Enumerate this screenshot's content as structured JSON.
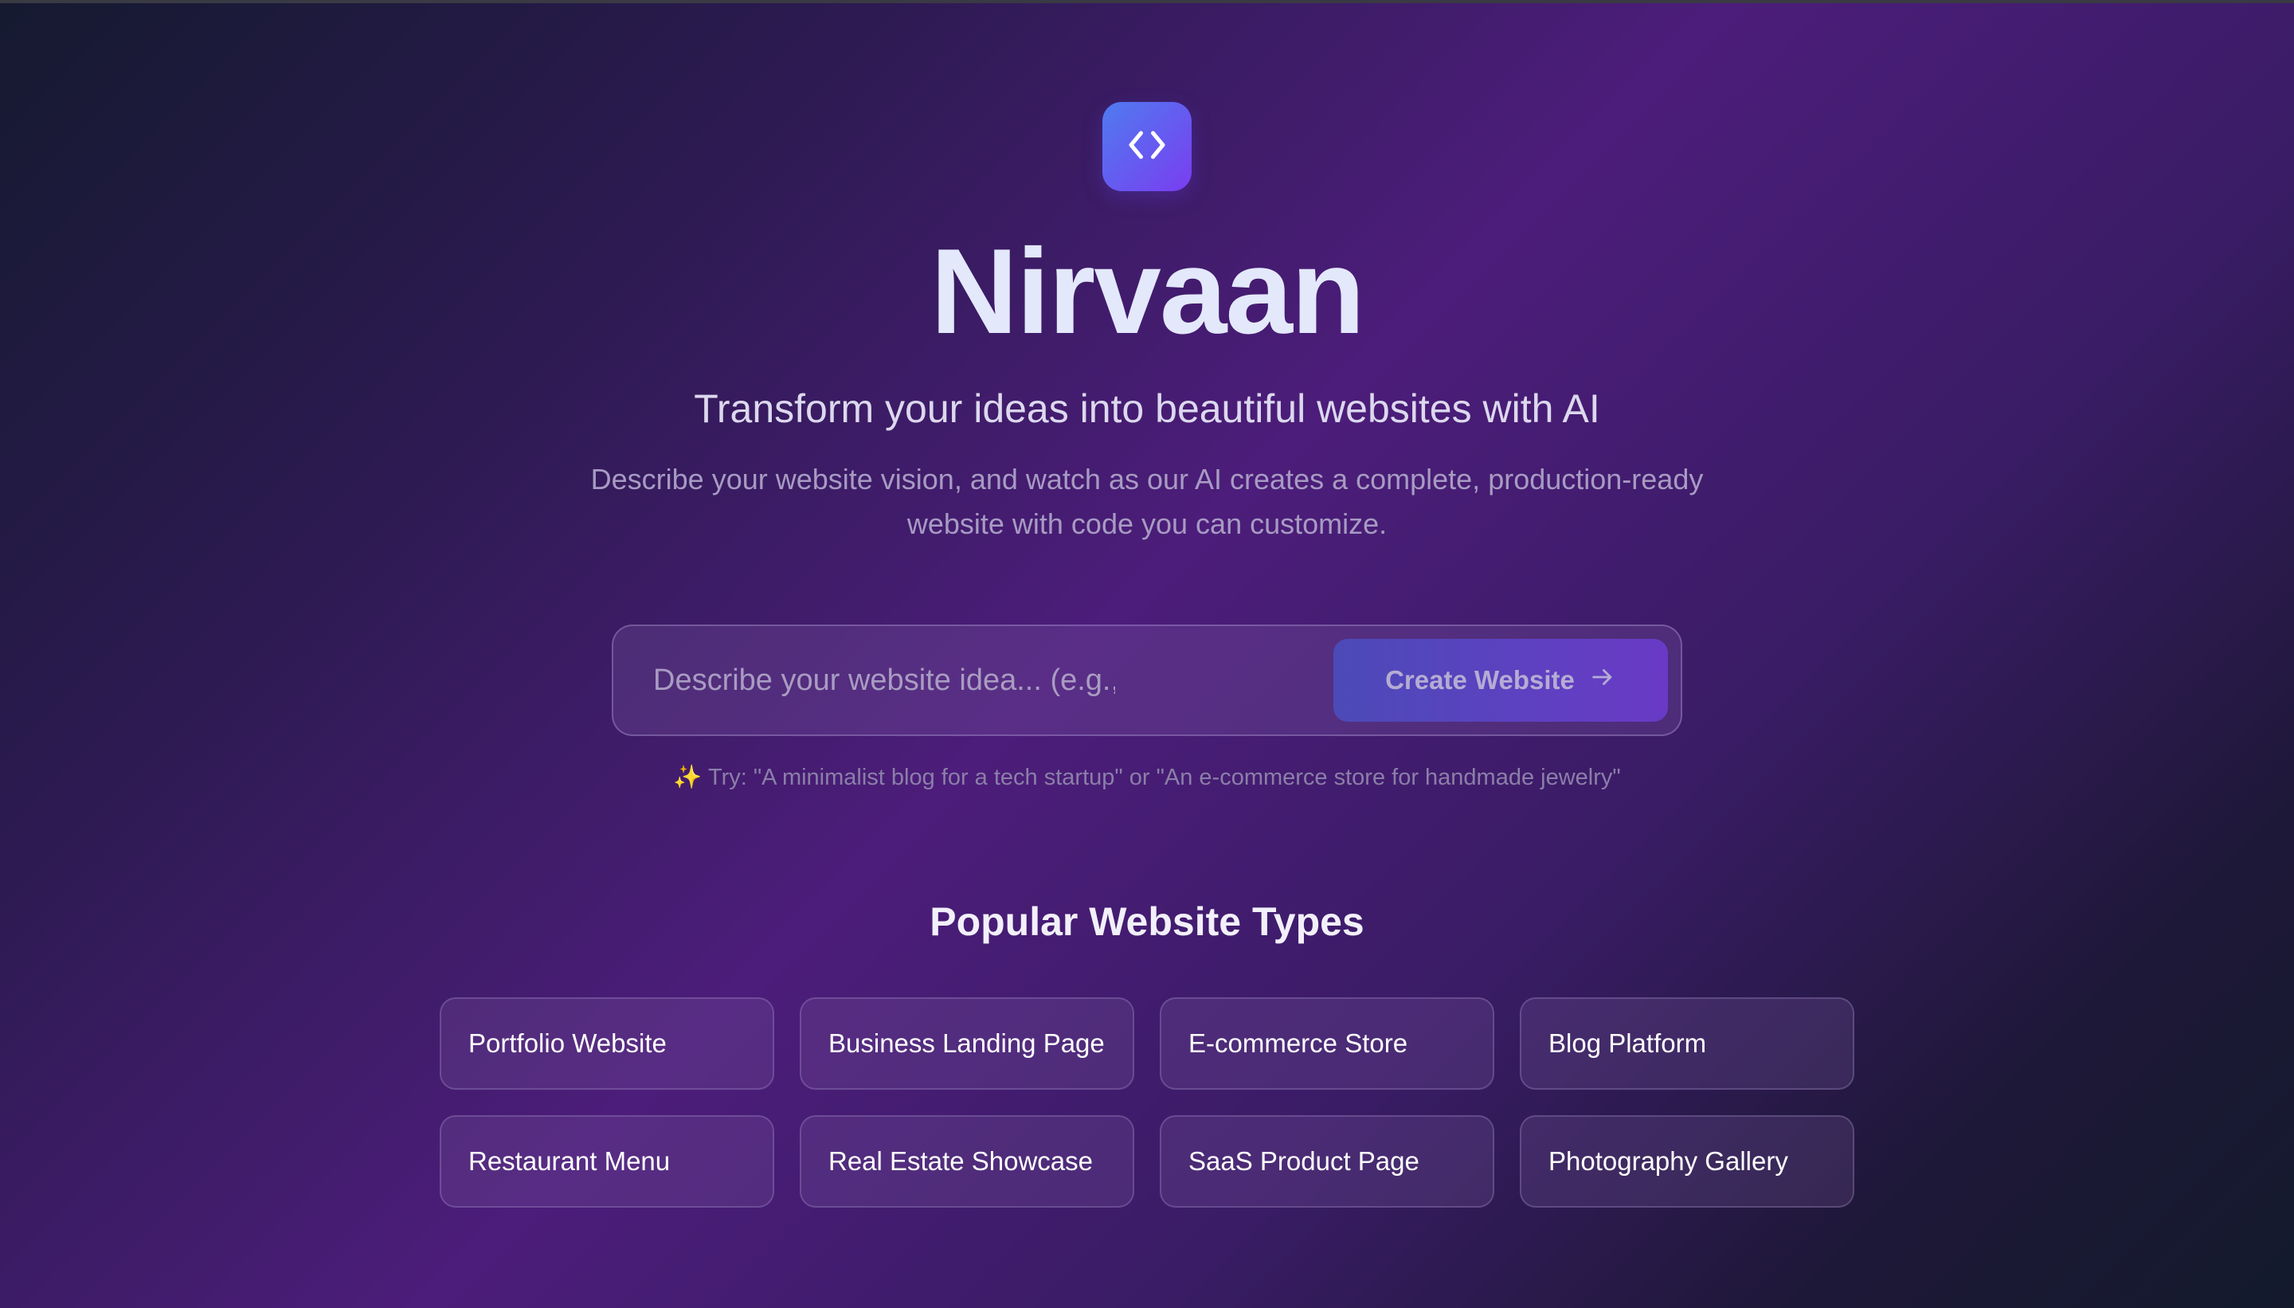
{
  "app": {
    "logo_icon": "code-brackets-icon",
    "title": "Nirvaan",
    "subtitle": "Transform your ideas into beautiful websites with AI",
    "description": "Describe your website vision, and watch as our AI creates a complete, production-ready website with code you can customize."
  },
  "prompt": {
    "placeholder": "Describe your website idea... (e.g., 'A modern p",
    "value": "",
    "button_label": "Create Website",
    "button_icon": "arrow-right-icon",
    "hint": "✨ Try: \"A minimalist blog for a tech startup\" or \"An e-commerce store for handmade jewelry\""
  },
  "popular": {
    "title": "Popular Website Types",
    "items": [
      {
        "label": "Portfolio Website"
      },
      {
        "label": "Business Landing Page"
      },
      {
        "label": "E-commerce Store"
      },
      {
        "label": "Blog Platform"
      },
      {
        "label": "Restaurant Menu"
      },
      {
        "label": "Real Estate Showcase"
      },
      {
        "label": "SaaS Product Page"
      },
      {
        "label": "Photography Gallery"
      }
    ]
  },
  "colors": {
    "accent_start": "#4f7bf0",
    "accent_end": "#7a3df0",
    "title_color": "#e3e8fb"
  }
}
